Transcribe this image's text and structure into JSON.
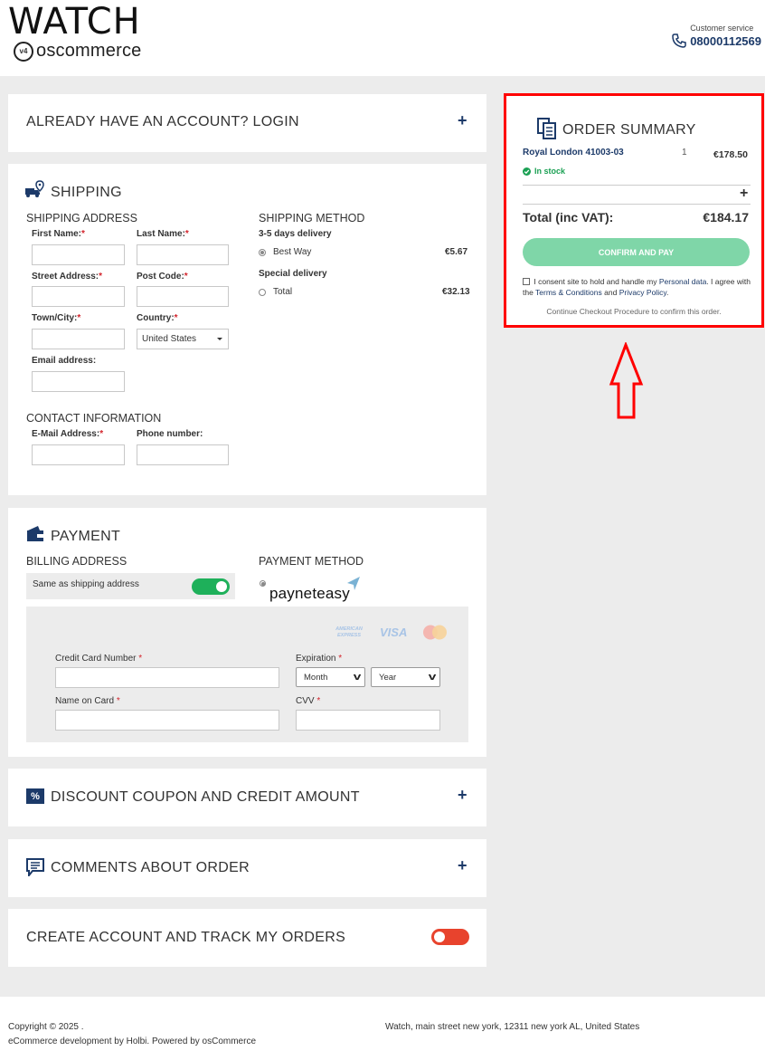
{
  "header": {
    "logo_main": "WATCH",
    "logo_sub": "oscommerce",
    "logo_badge": "v4",
    "customer_service_label": "Customer service",
    "phone": "08000112569"
  },
  "login_panel": {
    "title": "ALREADY HAVE AN ACCOUNT? LOGIN"
  },
  "shipping": {
    "title": "SHIPPING",
    "address_heading": "SHIPPING ADDRESS",
    "first_name_label": "First Name:",
    "last_name_label": "Last Name:",
    "street_label": "Street Address:",
    "post_code_label": "Post Code:",
    "town_label": "Town/City:",
    "country_label": "Country:",
    "country_value": "United States",
    "email_label": "Email address:",
    "req": "*",
    "method_heading": "SHIPPING METHOD",
    "method_group1": "3-5 days delivery",
    "method1_name": "Best Way",
    "method1_price": "€5.67",
    "method_group2": "Special delivery",
    "method2_name": "Total",
    "method2_price": "€32.13",
    "contact_heading": "CONTACT INFORMATION",
    "contact_email_label": "E-Mail Address:",
    "phone_label": "Phone number:"
  },
  "payment": {
    "title": "PAYMENT",
    "billing_heading": "BILLING ADDRESS",
    "same_as_shipping": "Same as shipping address",
    "same_as_shipping_on": true,
    "method_heading": "PAYMENT METHOD",
    "provider": "payneteasy",
    "card_amex": "AMERICAN EXPRESS",
    "card_visa": "VISA",
    "cc_number_label": "Credit Card Number",
    "expiration_label": "Expiration",
    "month_value": "Month",
    "year_value": "Year",
    "name_on_card_label": "Name on Card",
    "cvv_label": "CVV",
    "req": "*"
  },
  "discount_panel": {
    "title": "DISCOUNT COUPON AND CREDIT AMOUNT"
  },
  "comments_panel": {
    "title": "COMMENTS ABOUT ORDER"
  },
  "create_account_panel": {
    "title": "CREATE ACCOUNT AND TRACK MY ORDERS",
    "toggle_on": false
  },
  "order_summary": {
    "title": "ORDER SUMMARY",
    "product_name": "Royal London 41003-03",
    "product_qty": "1",
    "product_price": "€178.50",
    "stock_status": "In stock",
    "total_label": "Total (inc VAT):",
    "total_value": "€184.17",
    "confirm_button": "CONFIRM AND PAY",
    "consent_pre": "I consent site to hold and handle my",
    "consent_link_personal": "Personal data",
    "consent_mid": ". I agree with the",
    "consent_link_terms": "Terms & Conditions",
    "consent_and": "and",
    "consent_link_privacy": "Privacy Policy",
    "consent_end": ".",
    "continue_note": "Continue Checkout Procedure to confirm this order."
  },
  "footer": {
    "copyright": "Copyright © 2025 .",
    "credits": "eCommerce development by Holbi. Powered by osCommerce",
    "address": "Watch, main street new york, 12311 new york AL, United States"
  },
  "colors": {
    "navy": "#1c3a69",
    "green_toggle": "#1eb05a",
    "red_toggle": "#e8432d",
    "confirm_button": "#7fd6a8",
    "highlight_red": "#ff0000",
    "in_stock_green": "#1aa053",
    "required_red": "#d3242c"
  }
}
